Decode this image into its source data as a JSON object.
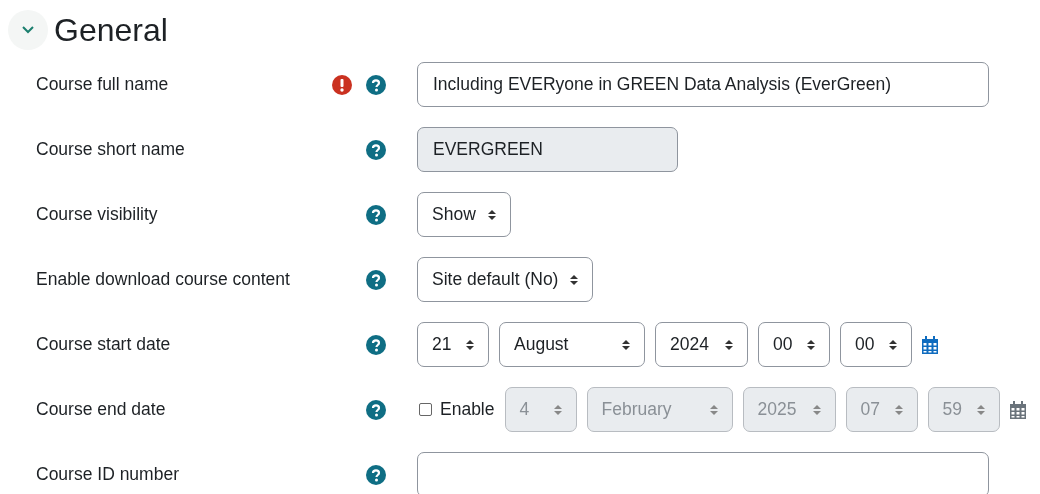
{
  "section": {
    "title": "General",
    "expanded": true
  },
  "rows": [
    {
      "label": "Course full name",
      "required": true,
      "kind": "text",
      "value": "Including EVERyone in GREEN Data Analysis (EverGreen)",
      "disabled": false
    },
    {
      "label": "Course short name",
      "required": false,
      "kind": "text",
      "value": "EVERGREEN",
      "disabled": true
    },
    {
      "label": "Course visibility",
      "required": false,
      "kind": "select",
      "value": "Show"
    },
    {
      "label": "Enable download course content",
      "required": false,
      "kind": "select",
      "value": "Site default (No)"
    },
    {
      "label": "Course start date",
      "required": false,
      "kind": "date",
      "parts": [
        "21",
        "August",
        "2024",
        "00",
        "00"
      ],
      "disabled": false
    },
    {
      "label": "Course end date",
      "required": false,
      "kind": "date",
      "enable": {
        "label": "Enable",
        "checked": false
      },
      "parts": [
        "4",
        "February",
        "2025",
        "07",
        "59"
      ],
      "disabled": true
    },
    {
      "label": "Course ID number",
      "required": false,
      "kind": "text",
      "value": "",
      "disabled": false
    }
  ]
}
